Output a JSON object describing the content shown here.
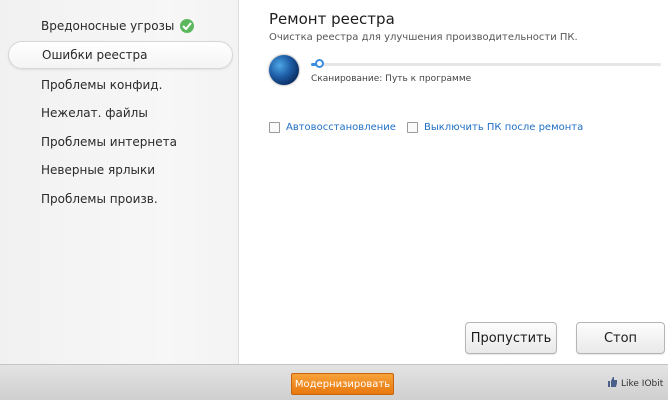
{
  "sidebar": {
    "items": [
      {
        "label": "Вредоносные угрозы",
        "status_icon": "check-icon"
      },
      {
        "label": "Ошибки реестра",
        "active": true
      },
      {
        "label": "Проблемы конфид."
      },
      {
        "label": "Нежелат. файлы"
      },
      {
        "label": "Проблемы интернета"
      },
      {
        "label": "Неверные ярлыки"
      },
      {
        "label": "Проблемы произв."
      }
    ]
  },
  "main": {
    "title": "Ремонт реестра",
    "subtitle": "Очистка реестра для улучшения производительности ПК.",
    "progress": 0.02,
    "scan_status": "Сканирование: Путь к программе",
    "options": [
      {
        "label": "Автовосстановление",
        "checked": false
      },
      {
        "label": "Выключить ПК после ремонта",
        "checked": false
      }
    ],
    "skip_label": "Пропустить",
    "stop_label": "Стоп"
  },
  "footer": {
    "upgrade_label": "Модернизировать",
    "like_label": "Like IObit"
  },
  "colors": {
    "accent": "#3a8de0",
    "upgrade": "#f08a20",
    "check": "#5cb85c",
    "link": "#1f6fc4"
  }
}
